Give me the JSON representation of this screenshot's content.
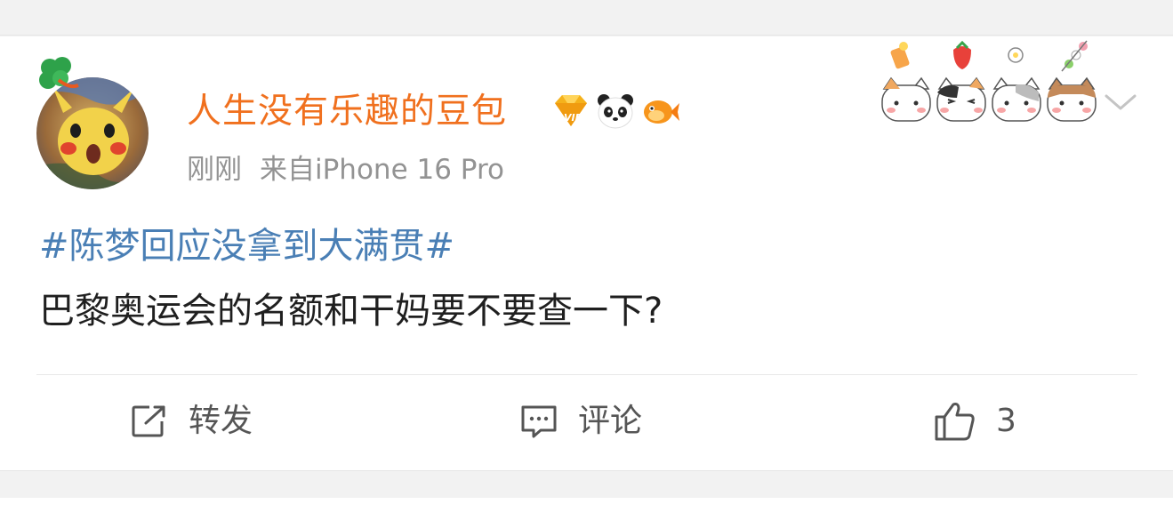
{
  "post": {
    "username": "人生没有乐趣的豆包",
    "time": "刚刚",
    "source": "来自iPhone 16 Pro",
    "topic": "#陈梦回应没拿到大满贯#",
    "text": "巴黎奥运会的名额和干妈要不要查一下?"
  },
  "badges": [
    "vip-gem-icon",
    "panda-icon",
    "goldfish-icon"
  ],
  "actions": {
    "repost_label": "转发",
    "comment_label": "评论",
    "like_count": "3"
  },
  "colors": {
    "username": "#f0701e",
    "topic": "#4a7fb5",
    "body_text": "#1f1f1f",
    "meta": "#939393",
    "action": "#555555",
    "background": "#f2f2f2",
    "card": "#ffffff"
  }
}
